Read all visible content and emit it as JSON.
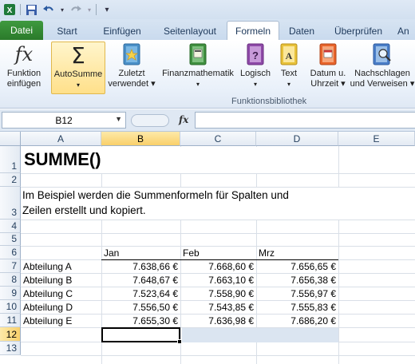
{
  "qat": {
    "app_icon": "excel-icon",
    "save_icon": "save-icon",
    "undo_icon": "undo-icon",
    "redo_icon": "redo-icon",
    "customize_icon": "customize-icon"
  },
  "tabs": [
    {
      "label": "Datei"
    },
    {
      "label": "Start"
    },
    {
      "label": "Einfügen"
    },
    {
      "label": "Seitenlayout"
    },
    {
      "label": "Formeln"
    },
    {
      "label": "Daten"
    },
    {
      "label": "Überprüfen"
    },
    {
      "label": "An"
    }
  ],
  "ribbon": {
    "insert_function": {
      "line1": "Funktion",
      "line2": "einfügen"
    },
    "autosum": {
      "line1": "AutoSumme",
      "line2": "▾"
    },
    "recent": {
      "line1": "Zuletzt",
      "line2": "verwendet ▾"
    },
    "financial": {
      "line1": "Finanzmathematik",
      "line2": "▾"
    },
    "logical": {
      "line1": "Logisch",
      "line2": "▾"
    },
    "text": {
      "line1": "Text",
      "line2": "▾"
    },
    "datetime": {
      "line1": "Datum u.",
      "line2": "Uhrzeit ▾"
    },
    "lookup": {
      "line1": "Nachschlagen",
      "line2": "und Verweisen ▾"
    },
    "group_label": "Funktionsbibliothek"
  },
  "formula_bar": {
    "name_box": "B12",
    "fx": "fx",
    "formula": ""
  },
  "columns": [
    "A",
    "B",
    "C",
    "D",
    "E"
  ],
  "rows": [
    "1",
    "2",
    "3",
    "4",
    "5",
    "6",
    "7",
    "8",
    "9",
    "10",
    "11",
    "12",
    "13"
  ],
  "sheet": {
    "title": "SUMME()",
    "description_line1": "Im Beispiel werden die Summenformeln für Spalten und",
    "description_line2": "Zeilen erstellt und kopiert.",
    "months": [
      "Jan",
      "Feb",
      "Mrz"
    ],
    "data": [
      {
        "dept": "Abteilung A",
        "values": [
          "7.638,66 €",
          "7.668,60 €",
          "7.656,65 €"
        ]
      },
      {
        "dept": "Abteilung B",
        "values": [
          "7.648,67 €",
          "7.663,10 €",
          "7.656,38 €"
        ]
      },
      {
        "dept": "Abteilung C",
        "values": [
          "7.523,64 €",
          "7.558,90 €",
          "7.556,97 €"
        ]
      },
      {
        "dept": "Abteilung D",
        "values": [
          "7.556,50 €",
          "7.543,85 €",
          "7.555,83 €"
        ]
      },
      {
        "dept": "Abteilung E",
        "values": [
          "7.655,30 €",
          "7.636,98 €",
          "7.686,20 €"
        ]
      }
    ]
  }
}
